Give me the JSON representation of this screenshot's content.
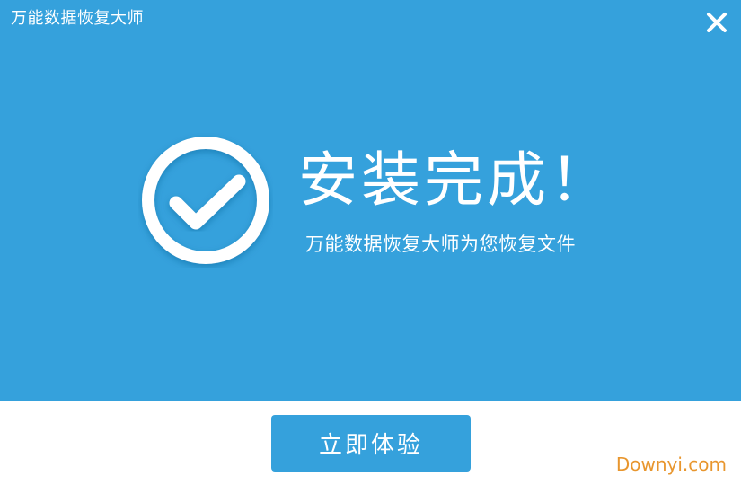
{
  "window": {
    "title": "万能数据恢复大师",
    "accent_color": "#35a1dc",
    "close_icon": "close-icon"
  },
  "main": {
    "status_icon": "check-circle-icon",
    "headline": "安装完成！",
    "subline": "万能数据恢复大师为您恢复文件"
  },
  "footer": {
    "primary_button_label": "立即体验"
  },
  "watermark": {
    "text": "Downyi.com",
    "color": "#e8962e"
  }
}
